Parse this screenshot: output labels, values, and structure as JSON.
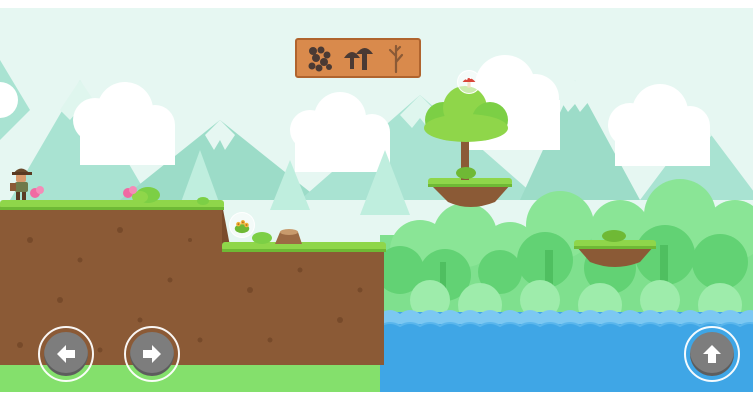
{
  "game": {
    "hud": {
      "collectibles": [
        {
          "item": "seed-pile-icon",
          "collected": false
        },
        {
          "item": "mushroom-icon",
          "collected": false
        },
        {
          "item": "twig-icon",
          "collected": true
        }
      ]
    },
    "controls": {
      "left": "arrow-left-icon",
      "right": "arrow-right-icon",
      "jump": "arrow-up-icon"
    },
    "pickups": [
      "mushroom-bubble",
      "flower-bubble"
    ],
    "colors": {
      "sky": "#dff4ee",
      "grass": "#8fd64a",
      "dirt": "#8b5a36",
      "water": "#3fa6e6",
      "hud_panel": "#d98a4c",
      "button": "#7d7d7d"
    }
  }
}
